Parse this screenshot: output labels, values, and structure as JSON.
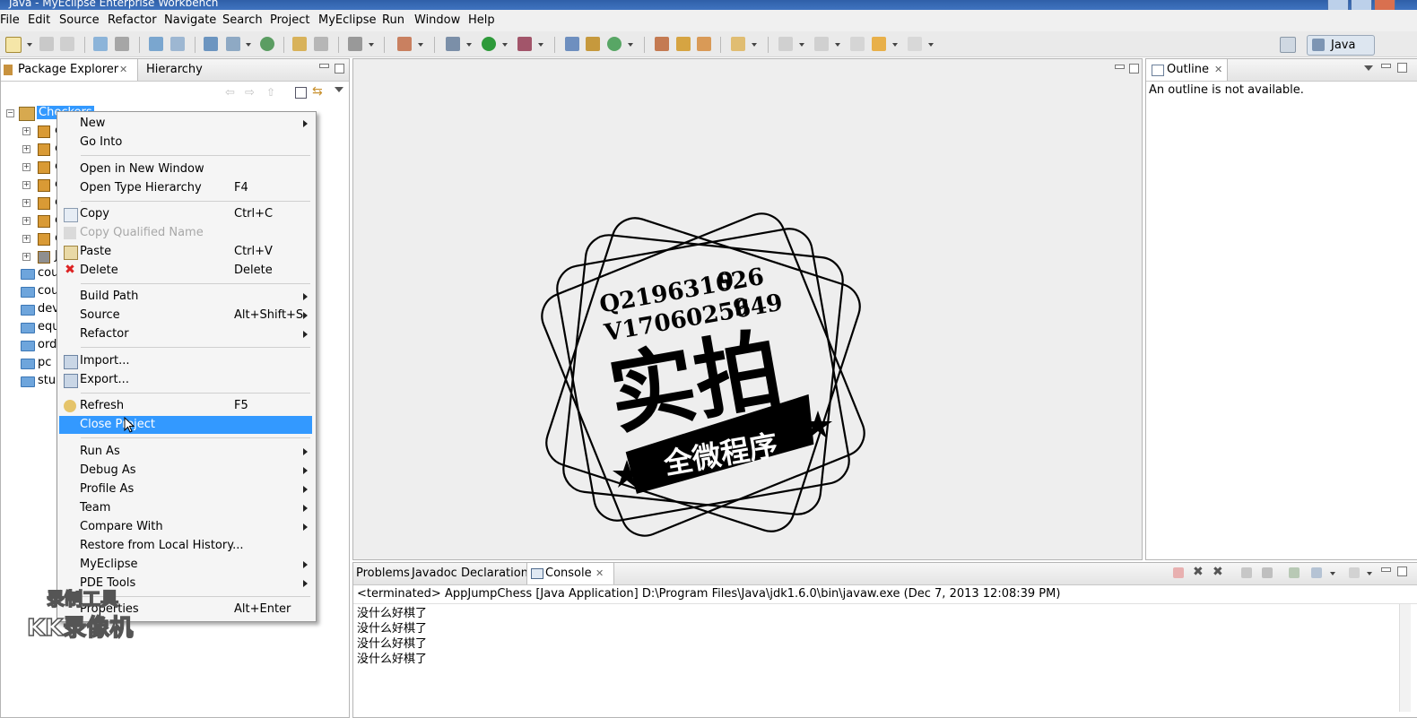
{
  "window": {
    "title": "Java - MyEclipse Enterprise Workbench"
  },
  "menu": [
    "File",
    "Edit",
    "Source",
    "Refactor",
    "Navigate",
    "Search",
    "Project",
    "MyEclipse",
    "Run",
    "Window",
    "Help"
  ],
  "perspective": {
    "label": "Java"
  },
  "package_explorer": {
    "tab": "Package Explorer",
    "other_tab": "Hierarchy",
    "project": "Checkers",
    "children_packages": [
      "c",
      "c",
      "c",
      "c",
      "c",
      "c",
      "c",
      "J"
    ],
    "folders": [
      "cou",
      "cou",
      "dev",
      "equ",
      "ord",
      "pc",
      "stu"
    ]
  },
  "context_menu": {
    "new": "New",
    "go_into": "Go Into",
    "open_new_window": "Open in New Window",
    "open_type_hierarchy": "Open Type Hierarchy",
    "open_type_hierarchy_sc": "F4",
    "copy": "Copy",
    "copy_sc": "Ctrl+C",
    "copy_qualified": "Copy Qualified Name",
    "paste": "Paste",
    "paste_sc": "Ctrl+V",
    "delete": "Delete",
    "delete_sc": "Delete",
    "build_path": "Build Path",
    "source": "Source",
    "source_sc": "Alt+Shift+S",
    "refactor": "Refactor",
    "import": "Import...",
    "export": "Export...",
    "refresh": "Refresh",
    "refresh_sc": "F5",
    "close_project": "Close Project",
    "run_as": "Run As",
    "debug_as": "Debug As",
    "profile_as": "Profile As",
    "team": "Team",
    "compare_with": "Compare With",
    "restore": "Restore from Local History...",
    "myeclipse": "MyEclipse",
    "pde_tools": "PDE Tools",
    "properties": "Properties",
    "properties_sc": "Alt+Enter"
  },
  "outline": {
    "tab": "Outline",
    "message": "An outline is not available."
  },
  "bottom_tabs": {
    "problems": "Problems",
    "javadoc": "Javadoc",
    "declaration": "Declaration",
    "console": "Console"
  },
  "console": {
    "header": "<terminated> AppJumpChess [Java Application] D:\\Program Files\\Java\\jdk1.6.0\\bin\\javaw.exe (Dec 7, 2013 12:08:39 PM)",
    "lines": [
      "没什么好棋了",
      "没什么好棋了",
      "没什么好棋了",
      "没什么好棋了"
    ]
  },
  "watermark": {
    "line1": "Q219631626",
    "line1_end": "9",
    "line2": "V1706025649",
    "line2_end": "9",
    "big_text": "实拍",
    "banner_text": "全微程序",
    "recorder_line1": "录制工具",
    "recorder_line2": "KK录像机"
  },
  "colors": {
    "selection": "#3399ff",
    "titlebar": "#3a6bb5",
    "editor_bg": "#eeeeee"
  }
}
